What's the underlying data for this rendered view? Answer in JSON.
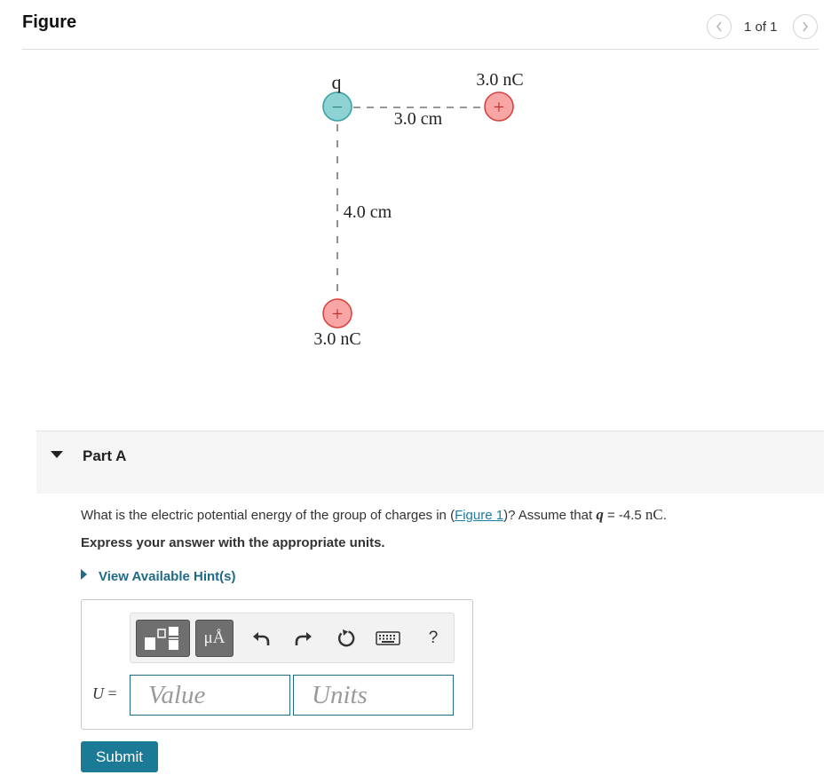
{
  "header": {
    "title": "Figure",
    "page_indicator": "1 of 1"
  },
  "figure": {
    "q_label": "q",
    "charge_top_right_label": "3.0 nC",
    "charge_bottom_label": "3.0 nC",
    "horizontal_distance": "3.0 cm",
    "vertical_distance": "4.0 cm",
    "negative_sign": "−",
    "positive_sign": "+",
    "colors": {
      "negative_fill": "#8ed3d4",
      "negative_stroke": "#3aa0a3",
      "positive_fill": "#f7a5a5",
      "positive_stroke": "#d9443f"
    }
  },
  "part": {
    "label": "Part A",
    "question_prefix": "What is the electric potential energy of the group of charges in (",
    "figure_link": "Figure 1",
    "question_middle": ")? Assume that ",
    "q_var": "q",
    "question_equals": " = -4.5 ",
    "q_unit": "nC",
    "question_end": ".",
    "instruction": "Express your answer with the appropriate units.",
    "hint_link": "View Available Hint(s)"
  },
  "answer": {
    "var_label": "U",
    "equals": " =",
    "value_placeholder": "Value",
    "units_placeholder": "Units",
    "units_button_label": "μÅ",
    "help_label": "?",
    "submit_label": "Submit"
  },
  "icons": [
    "chevron-left-icon",
    "chevron-right-icon",
    "templates-icon",
    "undo-icon",
    "redo-icon",
    "reset-icon",
    "keyboard-icon"
  ],
  "accent_color": "#1b7a95",
  "link_color": "#1a7fa3"
}
